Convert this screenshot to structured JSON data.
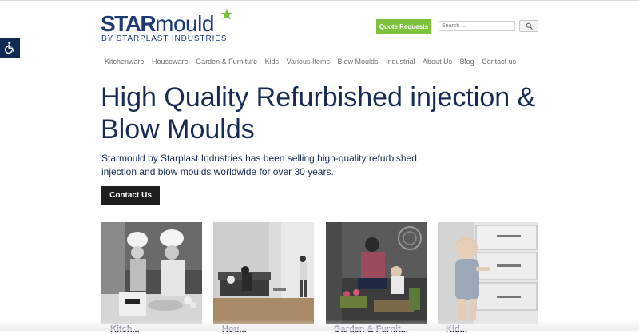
{
  "logo": {
    "main_bold": "STAR",
    "main_light": "mould",
    "tagline": "BY STARPLAST INDUSTRIES"
  },
  "header": {
    "quote_button": "Quote Requests",
    "search_placeholder": "Search ..."
  },
  "nav": {
    "items": [
      "Kitchenware",
      "Houseware",
      "Garden & Furniture",
      "Kids",
      "Various Items",
      "Blow Moulds",
      "Industrial",
      "About Us",
      "Blog",
      "Contact us"
    ]
  },
  "hero": {
    "title": "High Quality Refurbished injection & Blow Moulds",
    "text": "Starmould by Starplast Industries has been selling high-quality refurbished injection and blow moulds worldwide for over 30 years.",
    "cta": "Contact Us"
  },
  "categories": [
    {
      "label": "Kitch..."
    },
    {
      "label": "Hou..."
    },
    {
      "label": "Garden & Furnit..."
    },
    {
      "label": "Kid..."
    }
  ],
  "colors": {
    "navy": "#172b54",
    "green": "#7dc13c",
    "dark_button": "#1e1e1e",
    "accessibility": "#102a54"
  }
}
